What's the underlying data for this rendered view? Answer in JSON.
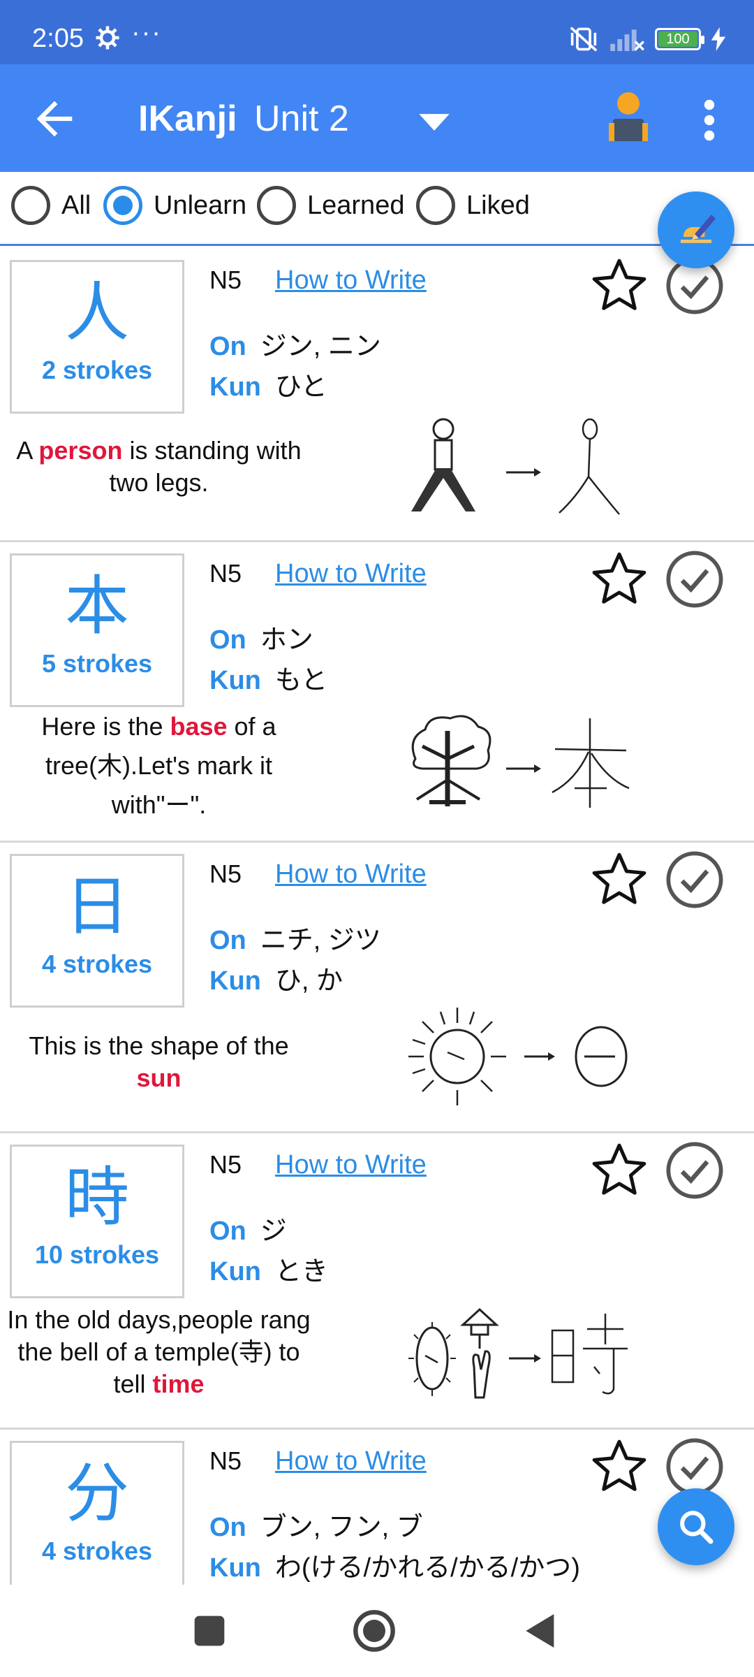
{
  "status_bar": {
    "time": "2:05",
    "dots": "···",
    "battery": "100"
  },
  "app_bar": {
    "title": "IKanji",
    "unit": "Unit 2"
  },
  "filters": [
    {
      "label": "All",
      "selected": false
    },
    {
      "label": "Unlearn",
      "selected": true
    },
    {
      "label": "Learned",
      "selected": false
    },
    {
      "label": "Liked",
      "selected": false
    }
  ],
  "colors": {
    "accent": "#2b8de6",
    "app_bar": "#4285f4",
    "status_bar": "#3b6fd8",
    "keyword": "#e0173a"
  },
  "kanji_list": [
    {
      "char": "人",
      "strokes": "2 strokes",
      "level": "N5",
      "how_to_write": "How to Write",
      "on_label": "On",
      "on": "ジン, ニン",
      "kun_label": "Kun",
      "kun": "ひと",
      "mnemonic": {
        "a": "A ",
        "kw": "person",
        "b": " is standing with two legs."
      }
    },
    {
      "char": "本",
      "strokes": "5 strokes",
      "level": "N5",
      "how_to_write": "How to Write",
      "on_label": "On",
      "on": "ホン",
      "kun_label": "Kun",
      "kun": "もと",
      "mnemonic": {
        "a": "Here is the ",
        "kw": "base",
        "b": " of a tree(木).Let's mark it with\"ー\"."
      }
    },
    {
      "char": "日",
      "strokes": "4 strokes",
      "level": "N5",
      "how_to_write": "How to Write",
      "on_label": "On",
      "on": "ニチ, ジツ",
      "kun_label": "Kun",
      "kun": "ひ, か",
      "mnemonic": {
        "a": "This is the shape of the ",
        "kw": "sun",
        "b": ""
      }
    },
    {
      "char": "時",
      "strokes": "10 strokes",
      "level": "N5",
      "how_to_write": "How to Write",
      "on_label": "On",
      "on": "ジ",
      "kun_label": "Kun",
      "kun": "とき",
      "mnemonic": {
        "a": "In the old days,people rang the bell of a temple(寺) to tell ",
        "kw": "time",
        "b": ""
      }
    },
    {
      "char": "分",
      "strokes": "4 strokes",
      "level": "N5",
      "how_to_write": "How to Write",
      "on_label": "On",
      "on": "ブン, フン, ブ",
      "kun_label": "Kun",
      "kun": "わ(ける/かれる/かる/かつ)",
      "mnemonic": {
        "a": "",
        "kw": "",
        "b": ""
      }
    }
  ],
  "icons": {
    "fab_top": "pencil-hand-icon",
    "fab_bottom": "search-icon",
    "star": "star-outline-icon",
    "check": "check-circle-icon"
  }
}
